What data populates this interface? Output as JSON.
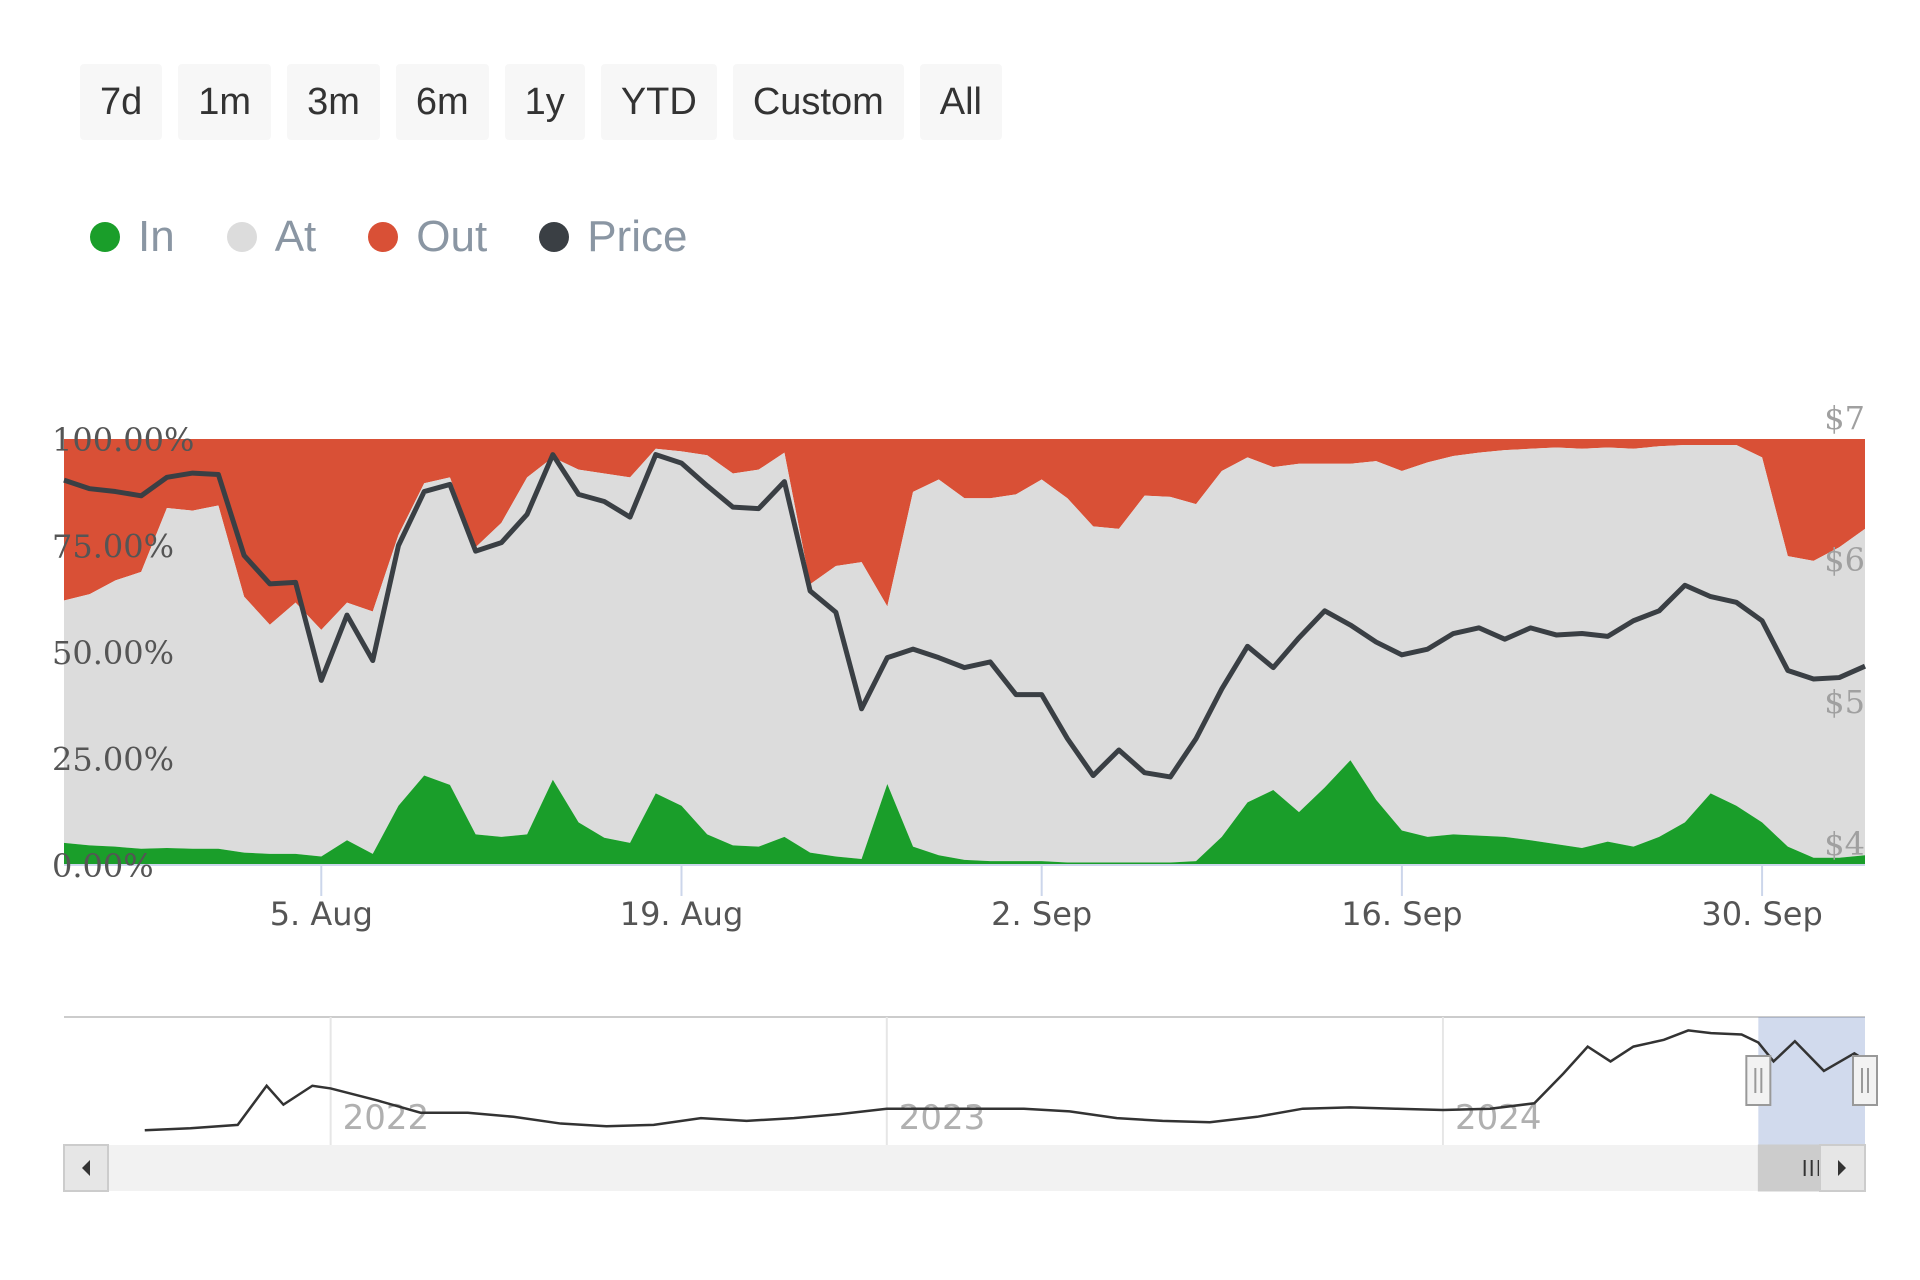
{
  "range_selector": {
    "buttons": [
      {
        "label": "7d"
      },
      {
        "label": "1m"
      },
      {
        "label": "3m"
      },
      {
        "label": "6m"
      },
      {
        "label": "1y"
      },
      {
        "label": "YTD"
      },
      {
        "label": "Custom"
      },
      {
        "label": "All"
      }
    ]
  },
  "legend": {
    "items": [
      {
        "label": "In",
        "color": "#1a9e2a"
      },
      {
        "label": "At",
        "color": "#dcdcdc"
      },
      {
        "label": "Out",
        "color": "#d95036"
      },
      {
        "label": "Price",
        "color": "#3a3f44"
      }
    ]
  },
  "chart_data": {
    "type": "area",
    "stacking": "percent",
    "legend_placement": "top-left",
    "grid": false,
    "x_ticks": [
      {
        "date": "2024-08-05",
        "label": "5. Aug"
      },
      {
        "date": "2024-08-19",
        "label": "19. Aug"
      },
      {
        "date": "2024-09-02",
        "label": "2. Sep"
      },
      {
        "date": "2024-09-16",
        "label": "16. Sep"
      },
      {
        "date": "2024-09-30",
        "label": "30. Sep"
      }
    ],
    "y_left": {
      "ticks": [
        "0.00%",
        "25.00%",
        "50.00%",
        "75.00%",
        "100.00%"
      ],
      "range": [
        0,
        100
      ]
    },
    "y_right": {
      "ticks": [
        "$4",
        "$5",
        "$6",
        "$7"
      ],
      "range": [
        4,
        7
      ]
    },
    "x": [
      "2024-07-26",
      "2024-07-27",
      "2024-07-28",
      "2024-07-29",
      "2024-07-30",
      "2024-07-31",
      "2024-08-01",
      "2024-08-02",
      "2024-08-03",
      "2024-08-04",
      "2024-08-05",
      "2024-08-06",
      "2024-08-07",
      "2024-08-08",
      "2024-08-09",
      "2024-08-10",
      "2024-08-11",
      "2024-08-12",
      "2024-08-13",
      "2024-08-14",
      "2024-08-15",
      "2024-08-16",
      "2024-08-17",
      "2024-08-18",
      "2024-08-19",
      "2024-08-20",
      "2024-08-21",
      "2024-08-22",
      "2024-08-23",
      "2024-08-24",
      "2024-08-25",
      "2024-08-26",
      "2024-08-27",
      "2024-08-28",
      "2024-08-29",
      "2024-08-30",
      "2024-08-31",
      "2024-09-01",
      "2024-09-02",
      "2024-09-03",
      "2024-09-04",
      "2024-09-05",
      "2024-09-06",
      "2024-09-07",
      "2024-09-08",
      "2024-09-09",
      "2024-09-10",
      "2024-09-11",
      "2024-09-12",
      "2024-09-13",
      "2024-09-14",
      "2024-09-15",
      "2024-09-16",
      "2024-09-17",
      "2024-09-18",
      "2024-09-19",
      "2024-09-20",
      "2024-09-21",
      "2024-09-22",
      "2024-09-23",
      "2024-09-24",
      "2024-09-25",
      "2024-09-26",
      "2024-09-27",
      "2024-09-28",
      "2024-09-29",
      "2024-09-30",
      "2024-10-01",
      "2024-10-02",
      "2024-10-03",
      "2024-10-04"
    ],
    "series": [
      {
        "name": "In",
        "color": "#1a9e2a",
        "axis": "left",
        "values": [
          5.2,
          4.6,
          4.3,
          3.8,
          4.0,
          3.8,
          3.8,
          2.9,
          2.6,
          2.6,
          2.0,
          5.8,
          2.6,
          13.9,
          21.0,
          18.8,
          7.2,
          6.6,
          7.2,
          20.0,
          10.0,
          6.4,
          5.2,
          16.8,
          13.9,
          7.2,
          4.6,
          4.3,
          6.6,
          2.9,
          2.0,
          1.4,
          19.0,
          4.3,
          2.3,
          1.2,
          0.9,
          0.9,
          0.9,
          0.6,
          0.6,
          0.6,
          0.6,
          0.6,
          0.9,
          6.6,
          14.7,
          17.6,
          12.4,
          18.2,
          24.6,
          15.3,
          8.1,
          6.6,
          7.2,
          6.9,
          6.6,
          5.8,
          4.9,
          4.0,
          5.5,
          4.3,
          6.6,
          10.0,
          16.8,
          13.9,
          10.0,
          4.3,
          1.7,
          1.7,
          2.3
        ]
      },
      {
        "name": "At",
        "color": "#dcdcdc",
        "axis": "left",
        "values": [
          56.9,
          59.0,
          62.5,
          65.0,
          79.8,
          79.4,
          80.6,
          60.1,
          53.8,
          59.0,
          53.2,
          55.8,
          56.9,
          63.6,
          68.6,
          72.2,
          67.4,
          73.7,
          83.8,
          75.7,
          82.8,
          85.5,
          85.8,
          80.9,
          83.2,
          89.0,
          87.3,
          88.5,
          90.2,
          63.0,
          68.2,
          69.7,
          41.7,
          83.3,
          88.2,
          84.9,
          85.2,
          86.1,
          89.6,
          85.5,
          78.9,
          78.3,
          86.1,
          85.8,
          83.8,
          85.9,
          81.0,
          75.8,
          81.8,
          76.0,
          69.6,
          79.5,
          84.4,
          87.9,
          88.8,
          89.9,
          90.8,
          91.9,
          93.1,
          93.7,
          92.5,
          93.4,
          91.7,
          88.6,
          81.8,
          84.7,
          85.7,
          68.2,
          69.7,
          72.9,
          76.6
        ]
      },
      {
        "name": "Out",
        "color": "#d95036",
        "axis": "left",
        "values": [
          37.9,
          36.4,
          33.2,
          31.2,
          16.2,
          16.8,
          15.6,
          37.0,
          43.6,
          38.4,
          44.8,
          38.4,
          40.5,
          22.5,
          10.4,
          9.0,
          25.4,
          19.7,
          9.0,
          4.3,
          7.2,
          8.1,
          9.0,
          2.3,
          2.9,
          3.8,
          8.1,
          7.2,
          3.2,
          34.1,
          29.8,
          28.9,
          39.3,
          12.4,
          9.5,
          13.9,
          13.9,
          13.0,
          9.5,
          13.9,
          20.5,
          21.1,
          13.3,
          13.6,
          15.3,
          7.5,
          4.3,
          6.6,
          5.8,
          5.8,
          5.8,
          5.2,
          7.5,
          5.5,
          4.0,
          3.2,
          2.6,
          2.3,
          2.0,
          2.3,
          2.0,
          2.3,
          1.7,
          1.4,
          1.4,
          1.4,
          4.3,
          27.5,
          28.6,
          25.4,
          21.1
        ]
      },
      {
        "name": "Price",
        "color": "#3a3f44",
        "axis": "right",
        "type": "line",
        "values": [
          6.71,
          6.65,
          6.63,
          6.6,
          6.73,
          6.76,
          6.75,
          6.18,
          5.98,
          5.99,
          5.3,
          5.76,
          5.44,
          6.25,
          6.63,
          6.68,
          6.21,
          6.27,
          6.47,
          6.89,
          6.61,
          6.56,
          6.45,
          6.89,
          6.83,
          6.67,
          6.52,
          6.51,
          6.7,
          5.93,
          5.78,
          5.1,
          5.46,
          5.52,
          5.46,
          5.39,
          5.43,
          5.2,
          5.2,
          4.89,
          4.63,
          4.81,
          4.65,
          4.62,
          4.89,
          5.24,
          5.54,
          5.39,
          5.6,
          5.79,
          5.69,
          5.57,
          5.48,
          5.52,
          5.63,
          5.67,
          5.59,
          5.67,
          5.62,
          5.63,
          5.61,
          5.72,
          5.79,
          5.97,
          5.89,
          5.85,
          5.72,
          5.37,
          5.31,
          5.32,
          5.4
        ]
      }
    ],
    "navigator": {
      "year_labels": [
        {
          "date": "2022-01-01",
          "label": "2022"
        },
        {
          "date": "2023-01-01",
          "label": "2023"
        },
        {
          "date": "2024-01-01",
          "label": "2024"
        }
      ],
      "selected_range": [
        "2024-07-26",
        "2024-10-04"
      ],
      "y_range": [
        0,
        8
      ],
      "points": [
        [
          "2021-09-01",
          0.2
        ],
        [
          "2021-10-01",
          0.35
        ],
        [
          "2021-11-01",
          0.6
        ],
        [
          "2021-11-20",
          3.5
        ],
        [
          "2021-12-01",
          2.1
        ],
        [
          "2021-12-20",
          3.5
        ],
        [
          "2022-01-01",
          3.3
        ],
        [
          "2022-02-01",
          2.4
        ],
        [
          "2022-03-01",
          1.5
        ],
        [
          "2022-04-01",
          1.5
        ],
        [
          "2022-05-01",
          1.2
        ],
        [
          "2022-06-01",
          0.7
        ],
        [
          "2022-07-01",
          0.5
        ],
        [
          "2022-08-01",
          0.6
        ],
        [
          "2022-09-01",
          1.1
        ],
        [
          "2022-10-01",
          0.9
        ],
        [
          "2022-11-01",
          1.1
        ],
        [
          "2022-12-01",
          1.4
        ],
        [
          "2023-01-01",
          1.8
        ],
        [
          "2023-02-01",
          1.8
        ],
        [
          "2023-03-01",
          1.8
        ],
        [
          "2023-04-01",
          1.8
        ],
        [
          "2023-05-01",
          1.6
        ],
        [
          "2023-06-01",
          1.1
        ],
        [
          "2023-07-01",
          0.9
        ],
        [
          "2023-08-01",
          0.8
        ],
        [
          "2023-09-01",
          1.2
        ],
        [
          "2023-10-01",
          1.8
        ],
        [
          "2023-11-01",
          1.9
        ],
        [
          "2023-12-01",
          1.8
        ],
        [
          "2024-01-01",
          1.7
        ],
        [
          "2024-02-01",
          1.8
        ],
        [
          "2024-03-01",
          2.2
        ],
        [
          "2024-03-20",
          4.4
        ],
        [
          "2024-04-05",
          6.4
        ],
        [
          "2024-04-20",
          5.3
        ],
        [
          "2024-05-05",
          6.4
        ],
        [
          "2024-05-25",
          6.9
        ],
        [
          "2024-06-10",
          7.6
        ],
        [
          "2024-06-25",
          7.4
        ],
        [
          "2024-07-15",
          7.3
        ],
        [
          "2024-07-26",
          6.7
        ],
        [
          "2024-08-05",
          5.3
        ],
        [
          "2024-08-19",
          6.8
        ],
        [
          "2024-09-07",
          4.6
        ],
        [
          "2024-09-27",
          5.9
        ],
        [
          "2024-10-04",
          5.4
        ]
      ]
    }
  }
}
